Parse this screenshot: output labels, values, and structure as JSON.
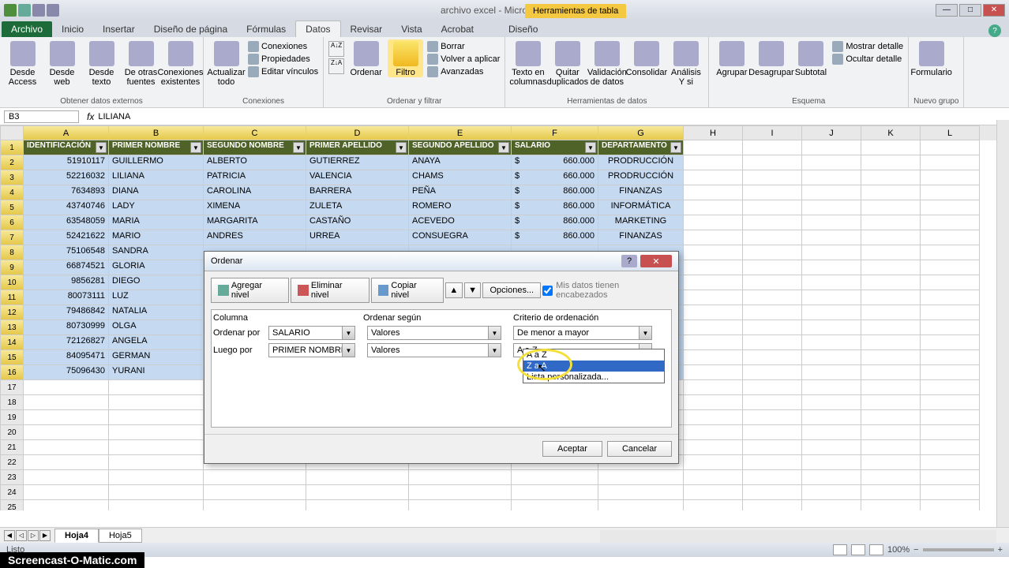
{
  "titlebar": {
    "title": "archivo excel - Microsoft Excel",
    "context_tab": "Herramientas de tabla"
  },
  "tabs": {
    "file": "Archivo",
    "list": [
      "Inicio",
      "Insertar",
      "Diseño de página",
      "Fórmulas",
      "Datos",
      "Revisar",
      "Vista",
      "Acrobat"
    ],
    "design": "Diseño",
    "active_index": 4
  },
  "ribbon": {
    "groups": [
      {
        "label": "Obtener datos externos",
        "big": [
          "Desde Access",
          "Desde web",
          "Desde texto",
          "De otras fuentes",
          "Conexiones existentes"
        ]
      },
      {
        "label": "Conexiones",
        "big": [
          "Actualizar todo"
        ],
        "small": [
          "Conexiones",
          "Propiedades",
          "Editar vínculos"
        ]
      },
      {
        "label": "Ordenar y filtrar",
        "big": [
          "Ordenar",
          "Filtro"
        ],
        "small": [
          "Borrar",
          "Volver a aplicar",
          "Avanzadas"
        ]
      },
      {
        "label": "Herramientas de datos",
        "big": [
          "Texto en columnas",
          "Quitar duplicados",
          "Validación de datos",
          "Consolidar",
          "Análisis Y si"
        ]
      },
      {
        "label": "Esquema",
        "big": [
          "Agrupar",
          "Desagrupar",
          "Subtotal"
        ],
        "small": [
          "Mostrar detalle",
          "Ocultar detalle"
        ]
      },
      {
        "label": "Nuevo grupo",
        "big": [
          "Formulario"
        ]
      }
    ],
    "sort_icons": [
      "A↓Z",
      "Z↓A"
    ]
  },
  "formula_bar": {
    "name_box": "B3",
    "fx": "fx",
    "formula": "LILIANA"
  },
  "columns": [
    "A",
    "B",
    "C",
    "D",
    "E",
    "F",
    "G",
    "H",
    "I",
    "J",
    "K",
    "L"
  ],
  "table": {
    "headers": [
      "IDENTIFICACIÓN",
      "PRIMER NOMBRE",
      "SEGUNDO NOMBRE",
      "PRIMER APELLIDO",
      "SEGUNDO APELLIDO",
      "SALARIO",
      "DEPARTAMENTO"
    ],
    "rows": [
      {
        "r": 2,
        "id": "51910117",
        "n1": "GUILLERMO",
        "n2": "ALBERTO",
        "a1": "GUTIERREZ",
        "a2": "ANAYA",
        "s": "660.000",
        "d": "PRODRUCCIÓN"
      },
      {
        "r": 3,
        "id": "52216032",
        "n1": "LILIANA",
        "n2": "PATRICIA",
        "a1": "VALENCIA",
        "a2": "CHAMS",
        "s": "660.000",
        "d": "PRODRUCCIÓN"
      },
      {
        "r": 4,
        "id": "7634893",
        "n1": "DIANA",
        "n2": "CAROLINA",
        "a1": "BARRERA",
        "a2": "PEÑA",
        "s": "860.000",
        "d": "FINANZAS"
      },
      {
        "r": 5,
        "id": "43740746",
        "n1": "LADY",
        "n2": "XIMENA",
        "a1": "ZULETA",
        "a2": "ROMERO",
        "s": "860.000",
        "d": "INFORMÁTICA"
      },
      {
        "r": 6,
        "id": "63548059",
        "n1": "MARIA",
        "n2": "MARGARITA",
        "a1": "CASTAÑO",
        "a2": "ACEVEDO",
        "s": "860.000",
        "d": "MARKETING"
      },
      {
        "r": 7,
        "id": "52421622",
        "n1": "MARIO",
        "n2": "ANDRES",
        "a1": "URREA",
        "a2": "CONSUEGRA",
        "s": "860.000",
        "d": "FINANZAS"
      },
      {
        "r": 8,
        "id": "75106548",
        "n1": "SANDRA"
      },
      {
        "r": 9,
        "id": "66874521",
        "n1": "GLORIA"
      },
      {
        "r": 10,
        "id": "9856281",
        "n1": "DIEGO"
      },
      {
        "r": 11,
        "id": "80073111",
        "n1": "LUZ"
      },
      {
        "r": 12,
        "id": "79486842",
        "n1": "NATALIA"
      },
      {
        "r": 13,
        "id": "80730999",
        "n1": "OLGA"
      },
      {
        "r": 14,
        "id": "72126827",
        "n1": "ANGELA"
      },
      {
        "r": 15,
        "id": "84095471",
        "n1": "GERMAN"
      },
      {
        "r": 16,
        "id": "75096430",
        "n1": "YURANI"
      }
    ]
  },
  "dialog": {
    "title": "Ordenar",
    "toolbar": {
      "add": "Agregar nivel",
      "del": "Eliminar nivel",
      "copy": "Copiar nivel",
      "options": "Opciones...",
      "headers_check": "Mis datos tienen encabezados"
    },
    "grid": {
      "cols": [
        "Columna",
        "",
        "Ordenar según",
        "Criterio de ordenación"
      ],
      "row1": {
        "label": "Ordenar por",
        "col": "SALARIO",
        "by": "Valores",
        "crit": "De menor a mayor"
      },
      "row2": {
        "label": "Luego por",
        "col": "PRIMER NOMBRE",
        "by": "Valores",
        "crit": "A a Z"
      }
    },
    "dropdown": {
      "opt1": "A a Z",
      "opt2": "Z a A",
      "opt3": "Lista personalizada..."
    },
    "footer": {
      "ok": "Aceptar",
      "cancel": "Cancelar"
    }
  },
  "sheets": {
    "tabs": [
      "Hoja4",
      "Hoja5"
    ],
    "active": 0
  },
  "statusbar": {
    "status": "Listo",
    "zoom": "100%"
  },
  "watermark": "Screencast-O-Matic.com",
  "salary_symbol": "$"
}
